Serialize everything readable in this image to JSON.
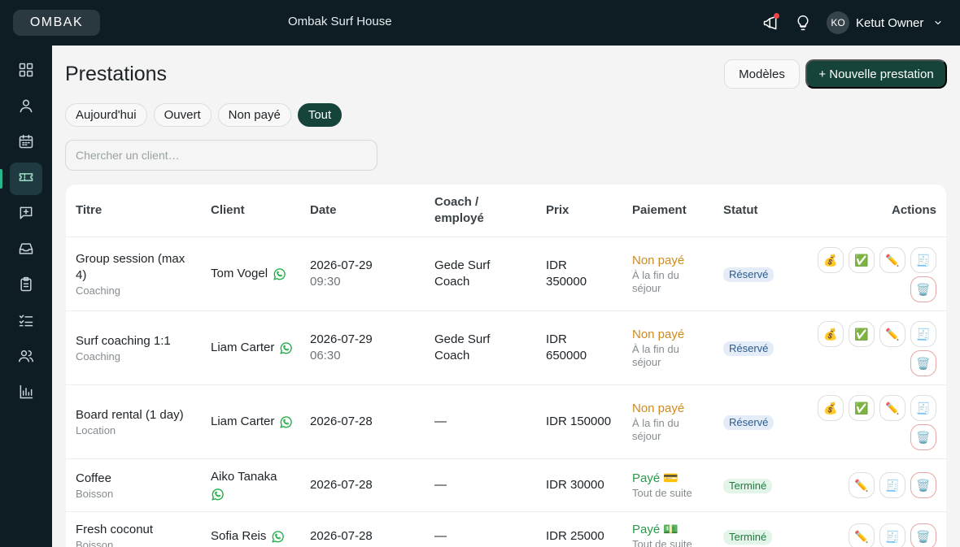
{
  "header": {
    "brand": "OMBAK",
    "venue": "Ombak Surf House",
    "user_initials": "KO",
    "user_name": "Ketut Owner"
  },
  "sidebar": {
    "items": [
      {
        "icon": "dashboard-grid-icon"
      },
      {
        "icon": "user-icon"
      },
      {
        "icon": "calendar-icon"
      },
      {
        "icon": "ticket-icon",
        "active": true
      },
      {
        "icon": "message-plus-icon"
      },
      {
        "icon": "inbox-icon"
      },
      {
        "icon": "clipboard-icon"
      },
      {
        "icon": "checklist-icon"
      },
      {
        "icon": "users-icon"
      },
      {
        "icon": "bar-chart-icon"
      }
    ]
  },
  "page": {
    "title": "Prestations",
    "models_button": "Modèles",
    "new_button": "+ Nouvelle prestation"
  },
  "filters": [
    "Aujourd'hui",
    "Ouvert",
    "Non payé",
    "Tout"
  ],
  "active_filter": "Tout",
  "search": {
    "placeholder": "Chercher un client…",
    "value": ""
  },
  "table": {
    "headers": {
      "title": "Titre",
      "client": "Client",
      "date": "Date",
      "coach_1": "Coach /",
      "coach_2": "employé",
      "price": "Prix",
      "payment": "Paiement",
      "status": "Statut",
      "actions": "Actions"
    },
    "rows": [
      {
        "title_1": "Group session (max",
        "title_2": "4)",
        "category": "Coaching",
        "client": "Tom Vogel",
        "date": "2026-07-29",
        "time": "09:30",
        "coach_1": "Gede Surf",
        "coach_2": "Coach",
        "price_1": "IDR",
        "price_2": "350000",
        "payment": "Non payé",
        "payment_note_1": "À la fin du",
        "payment_note_2": "séjour",
        "status": "Réservé",
        "actions": {
          "pay": "💰",
          "check": "✅",
          "edit": "✏️",
          "receipt": "🧾",
          "delete": "🗑️"
        }
      },
      {
        "title_1": "Surf coaching 1:1",
        "category": "Coaching",
        "client": "Liam Carter",
        "date": "2026-07-29",
        "time": "06:30",
        "coach_1": "Gede Surf",
        "coach_2": "Coach",
        "price_1": "IDR",
        "price_2": "650000",
        "payment": "Non payé",
        "payment_note_1": "À la fin du",
        "payment_note_2": "séjour",
        "status": "Réservé",
        "actions": {
          "pay": "💰",
          "check": "✅",
          "edit": "✏️",
          "receipt": "🧾",
          "delete": "🗑️"
        }
      },
      {
        "title_1": "Board rental (1 day)",
        "category": "Location",
        "client": "Liam Carter",
        "date": "2026-07-28",
        "coach_1": "—",
        "price_1": "IDR 150000",
        "payment": "Non payé",
        "payment_note_1": "À la fin du",
        "payment_note_2": "séjour",
        "status": "Réservé",
        "actions": {
          "pay": "💰",
          "check": "✅",
          "edit": "✏️",
          "receipt": "🧾",
          "delete": "🗑️"
        }
      },
      {
        "title_1": "Coffee",
        "category": "Boisson",
        "client": "Aiko Tanaka",
        "date": "2026-07-28",
        "coach_1": "—",
        "price_1": "IDR 30000",
        "payment": "Payé 💳",
        "payment_note_1": "Tout de suite",
        "status": "Terminé",
        "actions": {
          "edit": "✏️",
          "receipt": "🧾",
          "delete": "🗑️"
        }
      },
      {
        "title_1": "Fresh coconut",
        "category": "Boisson",
        "client": "Sofia Reis",
        "date": "2026-07-28",
        "coach_1": "—",
        "price_1": "IDR 25000",
        "payment": "Payé 💵",
        "payment_note_1": "Tout de suite",
        "status": "Terminé",
        "actions": {
          "edit": "✏️",
          "receipt": "🧾",
          "delete": "🗑️"
        }
      }
    ]
  },
  "colors": {
    "sidebar_bg": "#0e1d24",
    "primary": "#16443a",
    "accent": "#2bb58f",
    "unpaid": "#d08a1d",
    "paid": "#2a9a4a",
    "whatsapp": "#25b04a"
  }
}
